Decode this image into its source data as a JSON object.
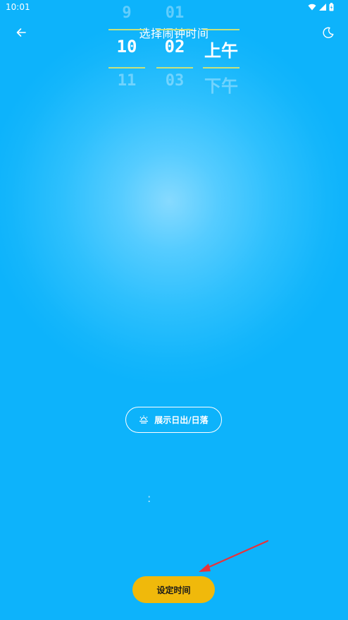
{
  "status_bar": {
    "time": "10:01",
    "icons": [
      "wifi-icon",
      "signal-icon",
      "battery-icon"
    ]
  },
  "header": {
    "title": "选择闹钟时间",
    "back_icon": "arrow-left-icon",
    "theme_icon": "moon-icon"
  },
  "sun_toggle": {
    "label": "展示日出/日落",
    "icon": "sunrise-icon"
  },
  "time_picker": {
    "hour": {
      "prev": "9",
      "selected": "10",
      "next": "11"
    },
    "separator": ":",
    "minute": {
      "prev": "01",
      "selected": "02",
      "next": "03"
    },
    "ampm": {
      "prev": "",
      "selected": "上午",
      "next": "下午"
    }
  },
  "actions": {
    "set_time_label": "设定时间"
  },
  "colors": {
    "background": "#0db3fb",
    "highlight": "#86daff",
    "divider": "#c8e27a",
    "button": "#f0b90b",
    "annotation_arrow": "#e8323a"
  }
}
